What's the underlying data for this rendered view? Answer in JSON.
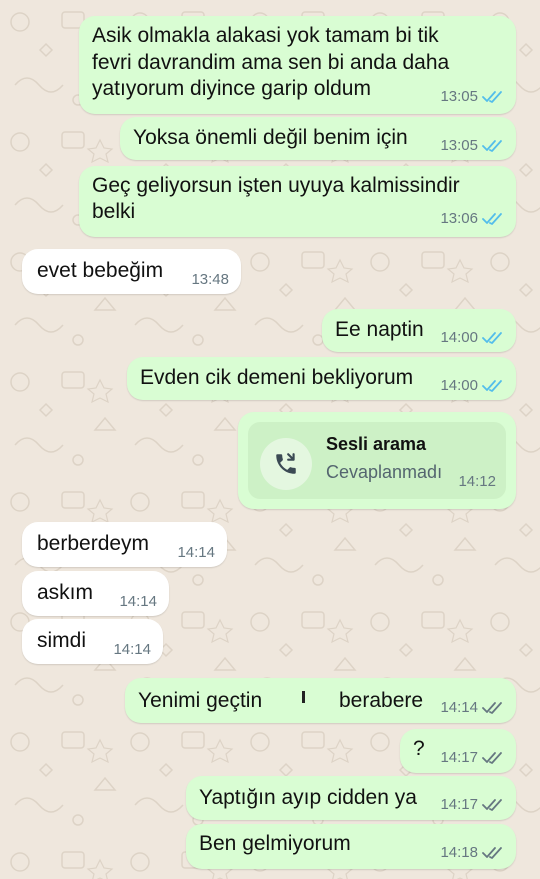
{
  "chat": {
    "messages": [
      {
        "lines": [
          "Asik olmakla alakasi yok tamam bi tik",
          "fevri davrandim ama sen bi anda daha",
          "yatıyorum diyince garip oldum"
        ],
        "time": "13:05",
        "status": "read"
      },
      {
        "lines": [
          "Yoksa önemli değil benim için"
        ],
        "time": "13:05",
        "status": "read"
      },
      {
        "lines": [
          "Geç geliyorsun işten uyuya kalmissindir",
          "belki"
        ],
        "time": "13:06",
        "status": "read"
      },
      {
        "lines": [
          "evet bebeğim"
        ],
        "time": "13:48"
      },
      {
        "lines": [
          "Ee naptin"
        ],
        "time": "14:00",
        "status": "read"
      },
      {
        "lines": [
          "Evden cik demeni bekliyorum"
        ],
        "time": "14:00",
        "status": "read"
      },
      {
        "call_title": "Sesli arama",
        "call_status": "Cevaplanmadı",
        "time": "14:12"
      },
      {
        "lines": [
          "berberdeym"
        ],
        "time": "14:14"
      },
      {
        "lines": [
          "askım"
        ],
        "time": "14:14"
      },
      {
        "lines": [
          "simdi"
        ],
        "time": "14:14"
      },
      {
        "lines": [
          "Yenimi geçtin",
          "berabere"
        ],
        "time": "14:14",
        "status": "delivered"
      },
      {
        "lines": [
          "?"
        ],
        "time": "14:17",
        "status": "delivered"
      },
      {
        "lines": [
          "Yaptığın ayıp cidden ya"
        ],
        "time": "14:17",
        "status": "delivered"
      },
      {
        "lines": [
          "Ben gelmiyorum"
        ],
        "time": "14:18",
        "status": "delivered"
      }
    ]
  },
  "colors": {
    "background": "#efe7dd",
    "outgoing_bubble": "#d9fdd3",
    "incoming_bubble": "#ffffff",
    "read_tick": "#53bdeb",
    "delivered_tick": "#667781",
    "timestamp": "#667781"
  },
  "icons": {
    "read": "double-check-blue-icon",
    "delivered": "double-check-gray-icon",
    "call": "missed-call-icon"
  }
}
